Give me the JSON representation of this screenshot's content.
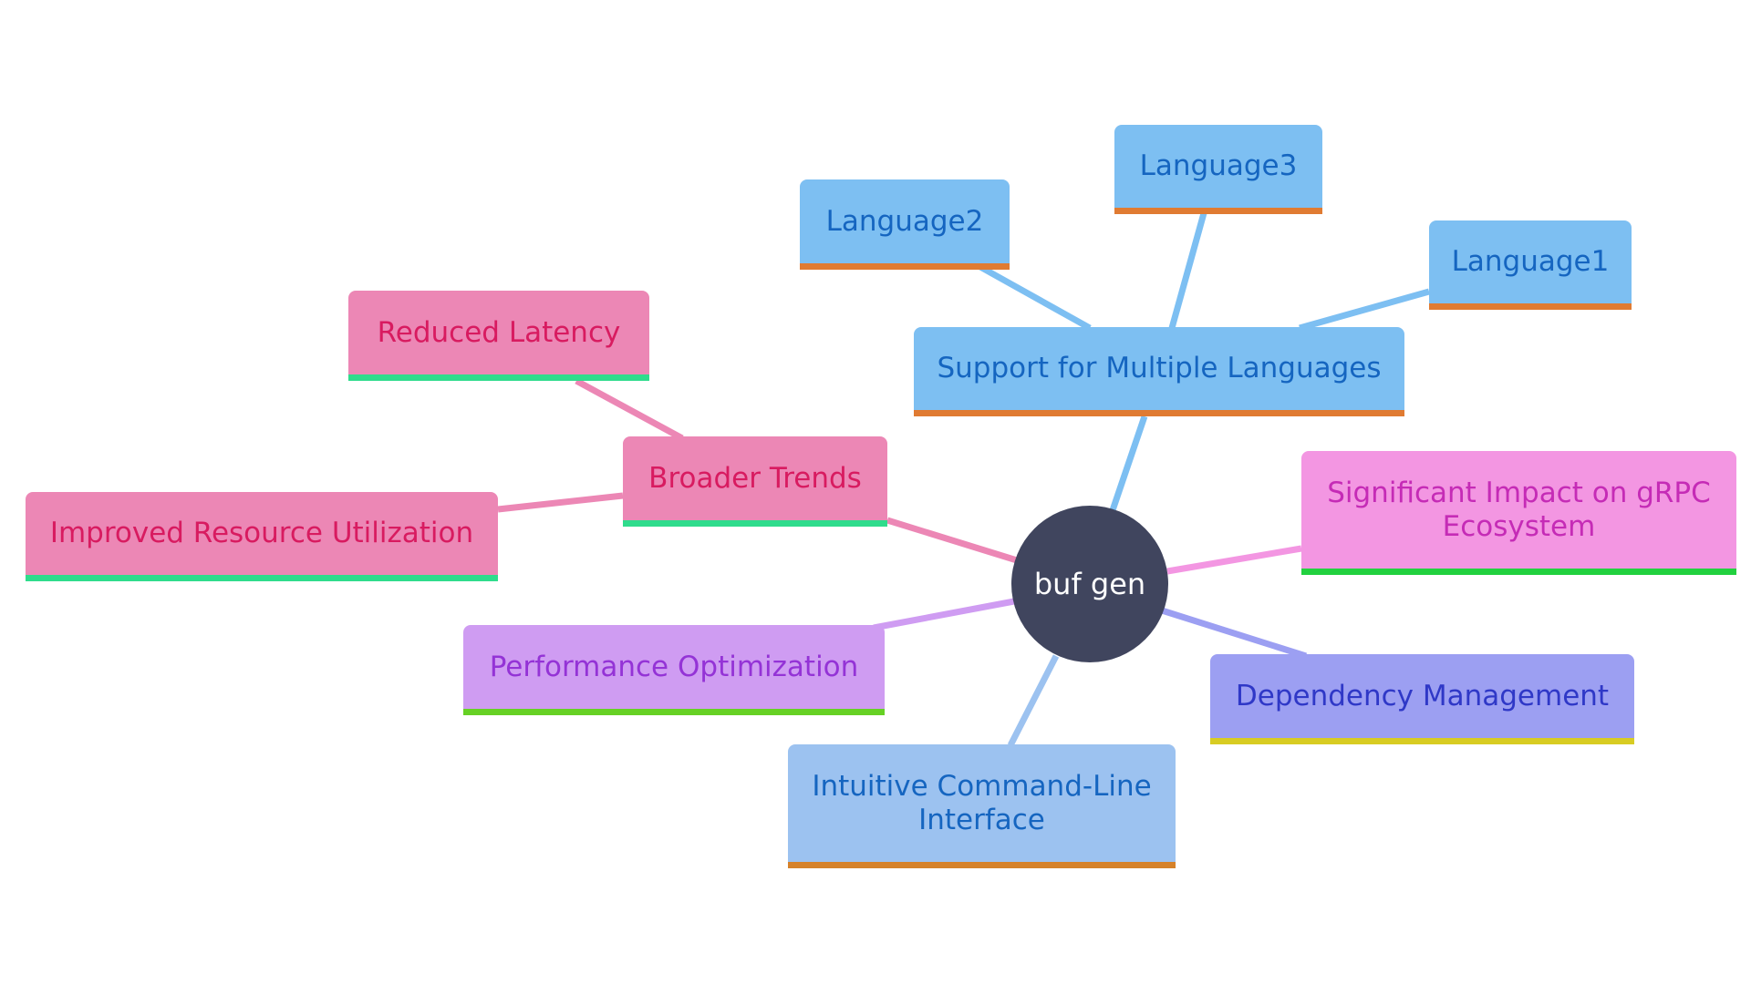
{
  "diagram": {
    "type": "mindmap",
    "root": {
      "label": "buf gen",
      "fill": "#40455e",
      "text_color": "#ffffff"
    },
    "nodes": [
      {
        "id": "support",
        "label": "Support for Multiple Languages",
        "parent": "root",
        "fill": "#7dbff2",
        "text_color": "#1565c0",
        "bar": "#e07b32",
        "edge": "#7dbff2"
      },
      {
        "id": "lang1",
        "label": "Language1",
        "parent": "support",
        "fill": "#7dbff2",
        "text_color": "#1565c0",
        "bar": "#e07b32",
        "edge": "#7dbff2"
      },
      {
        "id": "lang2",
        "label": "Language2",
        "parent": "support",
        "fill": "#7dbff2",
        "text_color": "#1565c0",
        "bar": "#e07b32",
        "edge": "#7dbff2"
      },
      {
        "id": "lang3",
        "label": "Language3",
        "parent": "support",
        "fill": "#7dbff2",
        "text_color": "#1565c0",
        "bar": "#e07b32",
        "edge": "#7dbff2"
      },
      {
        "id": "broader",
        "label": "Broader Trends",
        "parent": "root",
        "fill": "#ec87b5",
        "text_color": "#d81b60",
        "bar": "#2fdc8c",
        "edge": "#ec87b5"
      },
      {
        "id": "latency",
        "label": "Reduced Latency",
        "parent": "broader",
        "fill": "#ec87b5",
        "text_color": "#d81b60",
        "bar": "#2fdc8c",
        "edge": "#ec87b5"
      },
      {
        "id": "resource",
        "label": "Improved Resource Utilization",
        "parent": "broader",
        "fill": "#ec87b5",
        "text_color": "#d81b60",
        "bar": "#2fdc8c",
        "edge": "#ec87b5"
      },
      {
        "id": "impact",
        "label": "Significant Impact on gRPC Ecosystem",
        "parent": "root",
        "fill": "#f396e2",
        "text_color": "#c52bb6",
        "bar": "#22d13f",
        "edge": "#f396e2"
      },
      {
        "id": "perf",
        "label": "Performance Optimization",
        "parent": "root",
        "fill": "#cf9cf2",
        "text_color": "#9433d6",
        "bar": "#66d124",
        "edge": "#cf9cf2"
      },
      {
        "id": "dep",
        "label": "Dependency Management",
        "parent": "root",
        "fill": "#9c9ff2",
        "text_color": "#2f38c7",
        "bar": "#d8cc23",
        "edge": "#9c9ff2"
      },
      {
        "id": "cli",
        "label": "Intuitive Command-Line Interface",
        "parent": "root",
        "fill": "#9cc2f0",
        "text_color": "#1565c0",
        "bar": "#d6822a",
        "edge": "#9cc2f0"
      }
    ]
  }
}
